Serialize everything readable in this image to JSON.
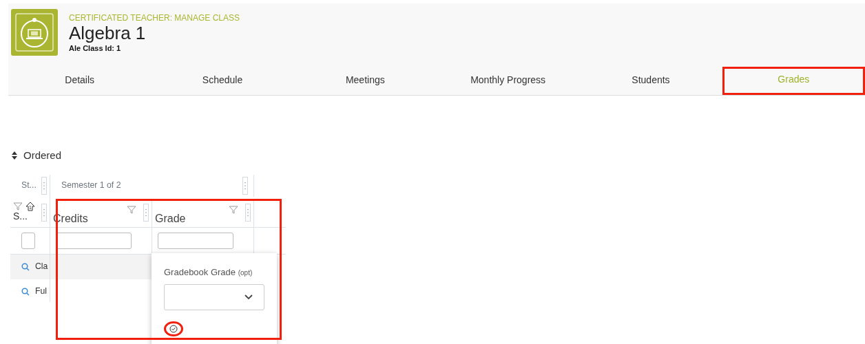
{
  "header": {
    "subtitle": "CERTIFICATED TEACHER: MANAGE CLASS",
    "title": "Algebra 1",
    "class_id": "Ale Class Id: 1"
  },
  "tabs": [
    {
      "label": "Details",
      "selected": false,
      "highlighted": false
    },
    {
      "label": "Schedule",
      "selected": false,
      "highlighted": false
    },
    {
      "label": "Meetings",
      "selected": false,
      "highlighted": false
    },
    {
      "label": "Monthly Progress",
      "selected": false,
      "highlighted": false
    },
    {
      "label": "Students",
      "selected": false,
      "highlighted": false
    },
    {
      "label": "Grades",
      "selected": true,
      "highlighted": true
    }
  ],
  "sort_toggle": {
    "label": "Ordered"
  },
  "grid": {
    "first_group_header": "St...",
    "group_header": "Semester 1 of 2",
    "highlighted": true,
    "columns": [
      {
        "label": "S...",
        "kind": "select",
        "sort_order": "1",
        "checked": false
      },
      {
        "label": "Credits",
        "kind": "text"
      },
      {
        "label": "Grade",
        "kind": "text"
      }
    ],
    "rows": [
      {
        "label": "Cla",
        "selected": true
      },
      {
        "label": "Ful",
        "selected": false
      }
    ]
  },
  "popup": {
    "label": "Gradebook Grade",
    "hint": "(opt)",
    "confirm_circled": true
  }
}
